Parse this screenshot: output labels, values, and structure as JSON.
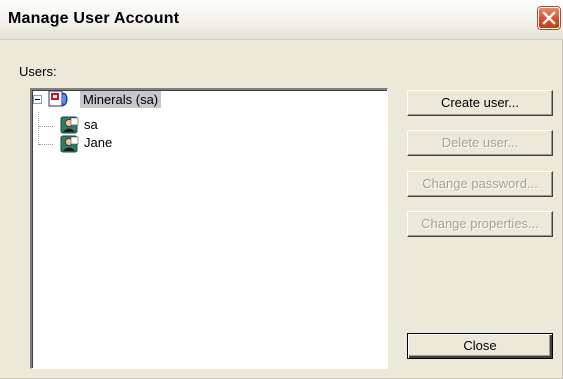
{
  "window": {
    "title": "Manage User Account",
    "close_icon": "close-icon"
  },
  "users": {
    "label": "Users:",
    "tree": {
      "root": {
        "label": "Minerals (sa)",
        "icon": "database-icon",
        "expanded": true,
        "selected": true,
        "children": [
          {
            "label": "sa",
            "icon": "user-icon"
          },
          {
            "label": "Jane",
            "icon": "user-icon"
          }
        ]
      }
    }
  },
  "buttons": {
    "create_user": {
      "label": "Create user...",
      "enabled": true
    },
    "delete_user": {
      "label": "Delete user...",
      "enabled": false
    },
    "change_password": {
      "label": "Change password...",
      "enabled": false
    },
    "change_properties": {
      "label": "Change properties...",
      "enabled": false
    },
    "close": {
      "label": "Close",
      "enabled": true
    }
  },
  "colors": {
    "dialog_background": "#ece9d8",
    "title_close_button": "#d2512b",
    "selection_highlight": "#c6c6cc",
    "disabled_text": "#a3a293"
  }
}
